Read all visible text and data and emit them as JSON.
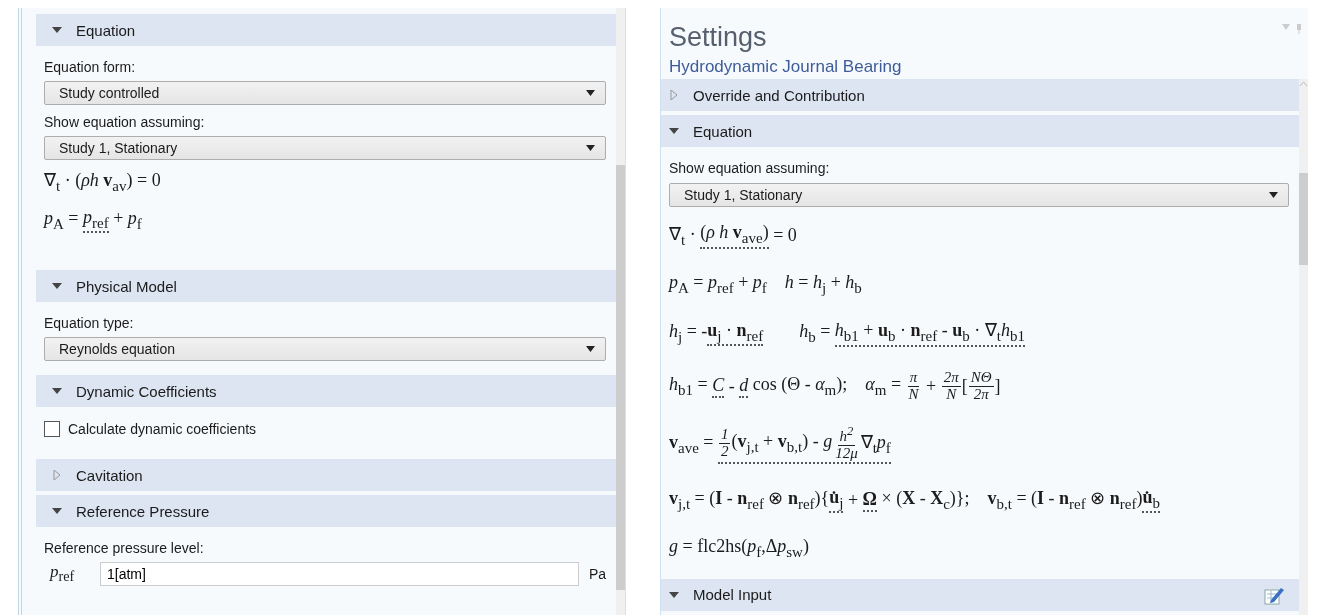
{
  "left_panel": {
    "sections": [
      {
        "title": "Equation",
        "expanded": true,
        "content": [
          {
            "kind": "label",
            "text": "Equation form:"
          },
          {
            "kind": "dropdown",
            "value": "Study controlled"
          },
          {
            "kind": "label",
            "text": "Show equation assuming:"
          },
          {
            "kind": "dropdown",
            "value": "Study 1, Stationary"
          },
          {
            "kind": "equation",
            "parts": [
              {
                "kind": "text",
                "text": "∇$_{t}$ · (*ρh* **v**$_{av}$) = 0"
              }
            ]
          },
          {
            "kind": "equation",
            "parts": [
              {
                "kind": "text",
                "text": "*p*$_{A}$ = "
              },
              {
                "kind": "dotted",
                "parts": [
                  {
                    "kind": "text",
                    "text": "*p*$_{ref}$"
                  }
                ]
              },
              {
                "kind": "text",
                "text": " + *p*$_{f}$"
              }
            ]
          }
        ]
      },
      {
        "title": "Physical Model",
        "expanded": true,
        "content": [
          {
            "kind": "label",
            "text": "Equation type:"
          },
          {
            "kind": "dropdown",
            "value": "Reynolds equation"
          }
        ]
      },
      {
        "title": "Dynamic Coefficients",
        "expanded": true,
        "content": [
          {
            "kind": "checkbox",
            "text": "Calculate dynamic coefficients",
            "checked": false
          }
        ]
      },
      {
        "title": "Cavitation",
        "expanded": false
      },
      {
        "title": "Reference Pressure",
        "expanded": true,
        "content": [
          {
            "kind": "label",
            "text": "Reference pressure level:"
          },
          {
            "kind": "field",
            "symbol": "*p*$_{ref}$",
            "value": "1[atm]",
            "unit": "Pa"
          }
        ]
      }
    ]
  },
  "right_panel": {
    "title": "Settings",
    "subtitle": "Hydrodynamic Journal Bearing",
    "sections": [
      {
        "title": "Override and Contribution",
        "expanded": false
      },
      {
        "title": "Equation",
        "expanded": true,
        "content": [
          {
            "kind": "label",
            "text": "Show equation assuming:"
          },
          {
            "kind": "dropdown",
            "value": "Study 1, Stationary"
          },
          {
            "kind": "equation",
            "parts": [
              {
                "kind": "text",
                "text": "∇$_{t}$ · "
              },
              {
                "kind": "dotted",
                "parts": [
                  {
                    "kind": "text",
                    "text": "(*ρ h* **v**$_{ave}$)"
                  }
                ]
              },
              {
                "kind": "text",
                "text": " = 0"
              }
            ]
          },
          {
            "kind": "equation",
            "parts": [
              {
                "kind": "text",
                "text": "*p*$_{A}$ = *p*$_{ref}$ + *p*$_{f}$    *h* = *h*$_{j}$ + *h*$_{b}$"
              }
            ]
          },
          {
            "kind": "equation",
            "parts": [
              {
                "kind": "text",
                "text": "*h*$_{j}$ = -"
              },
              {
                "kind": "dotted",
                "parts": [
                  {
                    "kind": "text",
                    "text": "**u**$_{j}$ · **n**$_{ref}$"
                  }
                ]
              },
              {
                "kind": "text",
                "text": "        *h*$_{b}$ = "
              },
              {
                "kind": "dotted",
                "parts": [
                  {
                    "kind": "text",
                    "text": "*h*$_{b1}$ + **u**$_{b}$ · **n**$_{ref}$ - **u**$_{b}$ · ∇$_{t}$*h*$_{b1}$"
                  }
                ]
              }
            ]
          },
          {
            "kind": "equation",
            "parts": [
              {
                "kind": "text",
                "text": "*h*$_{b1}$ = "
              },
              {
                "kind": "dotted",
                "parts": [
                  {
                    "kind": "text",
                    "text": "*C*"
                  }
                ]
              },
              {
                "kind": "text",
                "text": " - "
              },
              {
                "kind": "dotted",
                "parts": [
                  {
                    "kind": "text",
                    "text": "*d*"
                  }
                ]
              },
              {
                "kind": "text",
                "text": " cos (Θ - *α*$_{m}$);    *α*$_{m}$ = "
              },
              {
                "kind": "frac",
                "num": "π",
                "den": "N"
              },
              {
                "kind": "text",
                "text": " + "
              },
              {
                "kind": "frac",
                "num": "2π",
                "den": "N"
              },
              {
                "kind": "text",
                "text": "["
              },
              {
                "kind": "frac",
                "num": "NΘ",
                "den": "2π"
              },
              {
                "kind": "text",
                "text": "]"
              }
            ]
          },
          {
            "kind": "equation",
            "parts": [
              {
                "kind": "text",
                "text": "**v**$_{ave}$ = "
              },
              {
                "kind": "dotted",
                "parts": [
                  {
                    "kind": "frac",
                    "num": "1",
                    "den": "2"
                  },
                  {
                    "kind": "text",
                    "text": "(**v**$_{j,t}$ + **v**$_{b,t}$) - *g*"
                  },
                  {
                    "kind": "frac",
                    "num": "h$^{2}$",
                    "den": "12μ"
                  },
                  {
                    "kind": "text",
                    "text": "∇$_{t}$*p*$_{f}$"
                  }
                ]
              }
            ]
          },
          {
            "kind": "equation",
            "parts": [
              {
                "kind": "text",
                "text": "**v**$_{j,t}$ = (**I** - **n**$_{ref}$ ⊗ **n**$_{ref}$){"
              },
              {
                "kind": "dotted",
                "parts": [
                  {
                    "kind": "text",
                    "text": "**u̇**$_{j}$"
                  }
                ]
              },
              {
                "kind": "text",
                "text": " + "
              },
              {
                "kind": "dotted",
                "parts": [
                  {
                    "kind": "text",
                    "text": "**Ω**"
                  }
                ]
              },
              {
                "kind": "text",
                "text": " × (**X** - **X**$_{c}$)};    **v**$_{b,t}$ = (**I** - **n**$_{ref}$ ⊗ **n**$_{ref}$)"
              },
              {
                "kind": "dotted",
                "parts": [
                  {
                    "kind": "text",
                    "text": "**u̇**$_{b}$"
                  }
                ]
              }
            ]
          },
          {
            "kind": "equation",
            "parts": [
              {
                "kind": "text",
                "text": "*g* = flc2hs(*p*$_{f}$,Δ"
              },
              {
                "kind": "text",
                "text": "*p*$_{sw}$)"
              }
            ]
          }
        ]
      },
      {
        "title": "Model Input",
        "expanded": true,
        "edit_icon": true
      }
    ]
  }
}
